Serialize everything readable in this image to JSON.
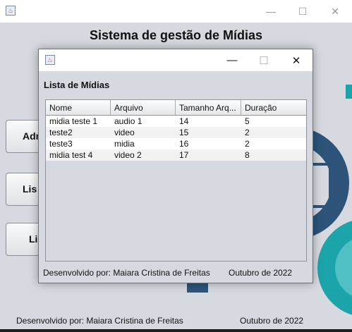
{
  "main": {
    "title": "Sistema de gestão de Mídias",
    "buttons": [
      "Adm",
      "Lis",
      "Li"
    ],
    "footer_left": "Desenvolvido por: Maiara Cristina de Freitas",
    "footer_right": "Outubro de 2022",
    "controls": {
      "minimize": "—",
      "maximize": "☐",
      "close": "✕"
    }
  },
  "dialog": {
    "heading": "Lista de Mídias",
    "controls": {
      "minimize": "—",
      "maximize": "☐",
      "close": "✕"
    },
    "table": {
      "columns": [
        "Nome",
        "Arquivo",
        "Tamanho Arq...",
        "Duração"
      ],
      "rows": [
        [
          "midia teste 1",
          "audio 1",
          "14",
          "5"
        ],
        [
          "teste2",
          "video",
          "15",
          "2"
        ],
        [
          "teste3",
          "midia",
          "16",
          "2"
        ],
        [
          "midia test 4",
          "video 2",
          "17",
          "8"
        ]
      ]
    },
    "footer_left": "Desenvolvido por: Maiara Cristina de Freitas",
    "footer_right": "Outubro de 2022"
  },
  "colors": {
    "gear_dark": "#2d5478",
    "gear_teal": "#1ba5ab",
    "background": "#d6d9df"
  }
}
